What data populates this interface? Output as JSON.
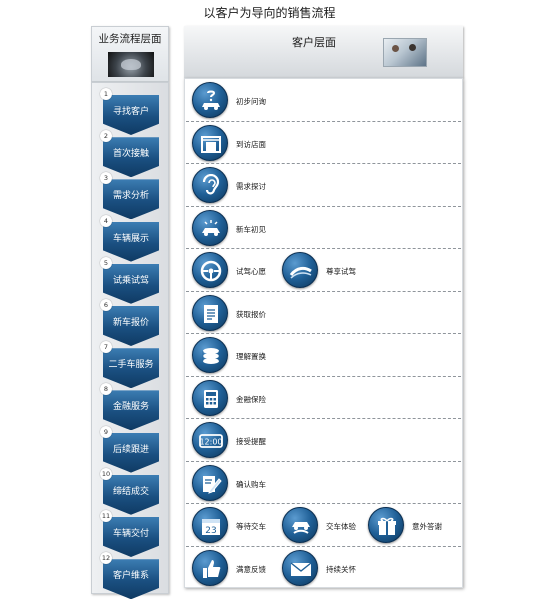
{
  "page_title": "以客户为导向的销售流程",
  "left_header": {
    "label": "业务流程层面"
  },
  "right_header": {
    "label": "客户层面"
  },
  "steps": [
    {
      "number": "1",
      "label": "寻找客户"
    },
    {
      "number": "2",
      "label": "首次接触"
    },
    {
      "number": "3",
      "label": "需求分析"
    },
    {
      "number": "4",
      "label": "车辆展示"
    },
    {
      "number": "5",
      "label": "试乘试驾"
    },
    {
      "number": "6",
      "label": "新车报价"
    },
    {
      "number": "7",
      "label": "二手车服务"
    },
    {
      "number": "8",
      "label": "金融服务"
    },
    {
      "number": "9",
      "label": "后续跟进"
    },
    {
      "number": "10",
      "label": "缔结成交"
    },
    {
      "number": "11",
      "label": "车辆交付"
    },
    {
      "number": "12",
      "label": "客户维系"
    }
  ],
  "rows": [
    [
      {
        "icon": "question-car-icon",
        "label": "初步问询"
      }
    ],
    [
      {
        "icon": "showroom-icon",
        "label": "到访店面"
      }
    ],
    [
      {
        "icon": "ear-icon",
        "label": "需求探讨"
      }
    ],
    [
      {
        "icon": "new-car-icon",
        "label": "新车初见"
      }
    ],
    [
      {
        "icon": "steering-wheel-icon",
        "label": "试驾心愿"
      },
      {
        "icon": "road-icon",
        "label": "尊享试驾"
      }
    ],
    [
      {
        "icon": "document-icon",
        "label": "获取报价"
      }
    ],
    [
      {
        "icon": "coins-icon",
        "label": "理解置换"
      }
    ],
    [
      {
        "icon": "calculator-icon",
        "label": "金融保险"
      }
    ],
    [
      {
        "icon": "digital-clock-icon",
        "label": "接受提醒"
      }
    ],
    [
      {
        "icon": "pen-paper-icon",
        "label": "确认购车"
      }
    ],
    [
      {
        "icon": "calendar-icon",
        "label": "等待交车"
      },
      {
        "icon": "handover-car-icon",
        "label": "交车体验"
      },
      {
        "icon": "gift-icon",
        "label": "意外答谢"
      }
    ],
    [
      {
        "icon": "thumbs-up-icon",
        "label": "满意反馈"
      },
      {
        "icon": "mail-icon",
        "label": "持续关怀"
      }
    ]
  ]
}
